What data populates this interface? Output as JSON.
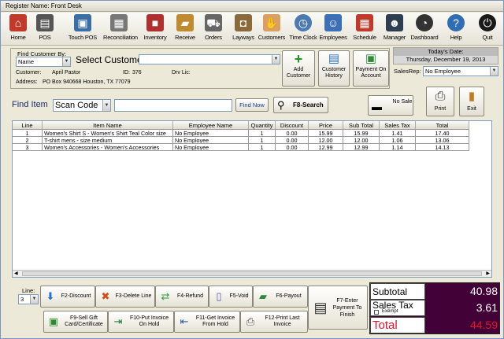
{
  "window": {
    "title": "Register Name: Front Desk"
  },
  "toolbar": [
    {
      "label": "Home",
      "icon": "home-icon"
    },
    {
      "label": "POS",
      "icon": "register-icon"
    },
    {
      "label": "Touch POS",
      "icon": "touch-register-icon"
    },
    {
      "label": "Reconciliation",
      "icon": "calculator-icon"
    },
    {
      "label": "Inventory",
      "icon": "box-icon"
    },
    {
      "label": "Receive",
      "icon": "truck-icon"
    },
    {
      "label": "Orders",
      "icon": "cart-icon"
    },
    {
      "label": "Layways",
      "icon": "bag-icon"
    },
    {
      "label": "Customers",
      "icon": "handshake-icon"
    },
    {
      "label": "Time Clock",
      "icon": "clock-icon"
    },
    {
      "label": "Employees",
      "icon": "people-icon"
    },
    {
      "label": "Schedule",
      "icon": "calendar-icon"
    },
    {
      "label": "Manager",
      "icon": "manager-icon"
    },
    {
      "label": "Dashboard",
      "icon": "gauge-icon"
    },
    {
      "label": "Help",
      "icon": "help-icon"
    },
    {
      "label": "Quit",
      "icon": "power-icon"
    }
  ],
  "customer": {
    "find_by_label": "Find Customer By:",
    "find_by_value": "Name",
    "select_label": "Select Customer",
    "select_value": "",
    "customer_label": "Customer:",
    "customer_name": "April Pastor",
    "id_label": "ID:",
    "id_value": "376",
    "drv_label": "Drv Lic:",
    "drv_value": "",
    "address_label": "Address:",
    "address_value": "PO Box 940668 Houston, TX 77079",
    "add_customer": "Add Customer",
    "customer_history": "Customer History",
    "payment_on_account": "Payment On Account"
  },
  "date": {
    "label": "Today's Date:",
    "value": "Thursday, December 19, 2013"
  },
  "salesrep": {
    "label": "SalesRep:",
    "value": "No Employee"
  },
  "find_item": {
    "label": "Find Item",
    "mode": "Scan Code",
    "value": "",
    "find_now": "Find Now",
    "f8_search": "F8-Search",
    "no_sale": "No Sale",
    "print": "Print",
    "exit": "Exit"
  },
  "grid": {
    "columns": [
      "Line",
      "Item Name",
      "Employee Name",
      "Quantity",
      "Discount",
      "Price",
      "Sub Total",
      "Sales Tax",
      "Total"
    ],
    "rows": [
      [
        "1",
        "Women's Shirt S - Women's Shirt Teal Color size",
        "No Employee",
        "1",
        "0.00",
        "15.99",
        "15.99",
        "1.41",
        "17.40"
      ],
      [
        "2",
        "T-shirt mens - size medium",
        "No Employee",
        "1",
        "0.00",
        "12.00",
        "12.00",
        "1.06",
        "13.06"
      ],
      [
        "3",
        "Women's Accessories - Women's Accessories",
        "No Employee",
        "1",
        "0.00",
        "12.99",
        "12.99",
        "1.14",
        "14.13"
      ]
    ]
  },
  "line_select": {
    "label": "Line:",
    "value": "3"
  },
  "functions": {
    "f2": "F2-Discount",
    "f3": "F3-Delete Line",
    "f4": "F4-Refund",
    "f5": "F5-Void",
    "f6": "F6-Payout",
    "f7": "F7-Enter Payment To Finish",
    "f9": "F9-Sell Gift Card/Certificate",
    "f10": "F10-Put Invoice On Hold",
    "f11": "F11-Get Invoice From Hold",
    "f12": "F12-Print Last Invoice"
  },
  "totals": {
    "subtotal_label": "Subtotal",
    "subtotal": "40.98",
    "tax_label": "Sales Tax",
    "tax": "3.61",
    "exempt_label": "Exempt",
    "total_label": "Total",
    "total": "44.59"
  },
  "colors": {
    "accent": "#420238",
    "total_red": "#e0142a"
  }
}
